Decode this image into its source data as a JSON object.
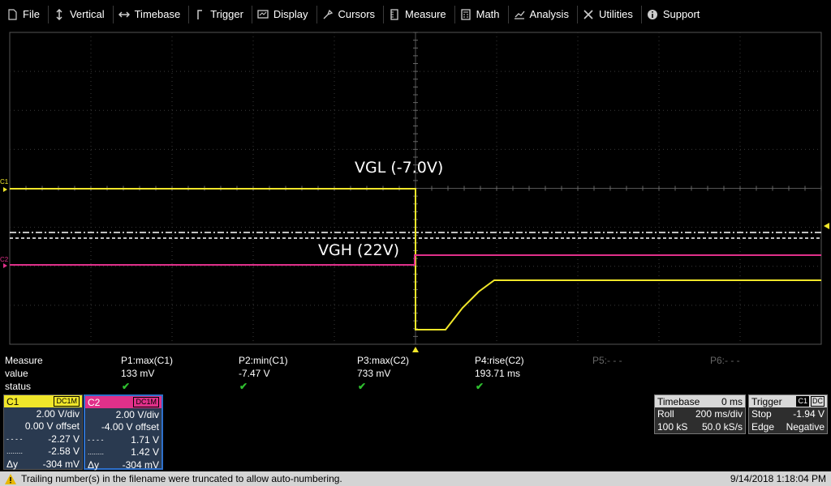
{
  "menu": [
    {
      "label": "File",
      "icon": "file-icon"
    },
    {
      "label": "Vertical",
      "icon": "vertical-arrows-icon"
    },
    {
      "label": "Timebase",
      "icon": "horizontal-arrows-icon"
    },
    {
      "label": "Trigger",
      "icon": "trigger-icon"
    },
    {
      "label": "Display",
      "icon": "display-icon"
    },
    {
      "label": "Cursors",
      "icon": "cursor-icon"
    },
    {
      "label": "Measure",
      "icon": "measure-icon"
    },
    {
      "label": "Math",
      "icon": "calculator-icon"
    },
    {
      "label": "Analysis",
      "icon": "chart-icon"
    },
    {
      "label": "Utilities",
      "icon": "tools-icon"
    },
    {
      "label": "Support",
      "icon": "info-icon"
    }
  ],
  "screen": {
    "ch1_marker": "C1",
    "ch2_marker": "C2",
    "annotation_vgl": "VGL (-7.0V)",
    "annotation_vgh": "VGH (22V)",
    "colors": {
      "c1": "#f0e62a",
      "c2": "#e0308a",
      "grid": "#3a3a3a"
    }
  },
  "measure": {
    "row_labels": {
      "header": "Measure",
      "value": "value",
      "status": "status"
    },
    "params": [
      {
        "name": "P1:max(C1)",
        "value": "133 mV",
        "status": "✔"
      },
      {
        "name": "P2:min(C1)",
        "value": "-7.47 V",
        "status": "✔"
      },
      {
        "name": "P3:max(C2)",
        "value": "733 mV",
        "status": "✔"
      },
      {
        "name": "P4:rise(C2)",
        "value": "193.71 ms",
        "status": "✔"
      },
      {
        "name": "P5:- - -",
        "value": "",
        "status": ""
      },
      {
        "name": "P6:- - -",
        "value": "",
        "status": ""
      }
    ]
  },
  "channels": [
    {
      "name": "C1",
      "coupling": "DC1M",
      "color": "#f0e62a",
      "vdiv": "2.00 V/div",
      "offset": "0.00 V offset",
      "cur1_label": "- - - -",
      "cur1": "-2.27 V",
      "cur2_label": "........",
      "cur2": "-2.58 V",
      "dy_label": "Δy",
      "dy": "-304 mV"
    },
    {
      "name": "C2",
      "coupling": "DC1M",
      "color": "#e0308a",
      "vdiv": "2.00 V/div",
      "offset": "-4.00 V offset",
      "cur1_label": "- - - -",
      "cur1": "1.71 V",
      "cur2_label": "........",
      "cur2": "1.42 V",
      "dy_label": "Δy",
      "dy": "-304 mV"
    }
  ],
  "timebase": {
    "title": "Timebase",
    "delay": "0 ms",
    "mode": "Roll",
    "tdiv": "200 ms/div",
    "samples": "100 kS",
    "rate": "50.0 kS/s"
  },
  "trigger": {
    "title": "Trigger",
    "source": "C1",
    "coupling": "DC",
    "state": "Stop",
    "level": "-1.94 V",
    "type": "Edge",
    "slope": "Negative"
  },
  "status": {
    "message": "Trailing number(s) in the filename were truncated to allow auto-numbering.",
    "datetime": "9/14/2018 1:18:04 PM"
  }
}
